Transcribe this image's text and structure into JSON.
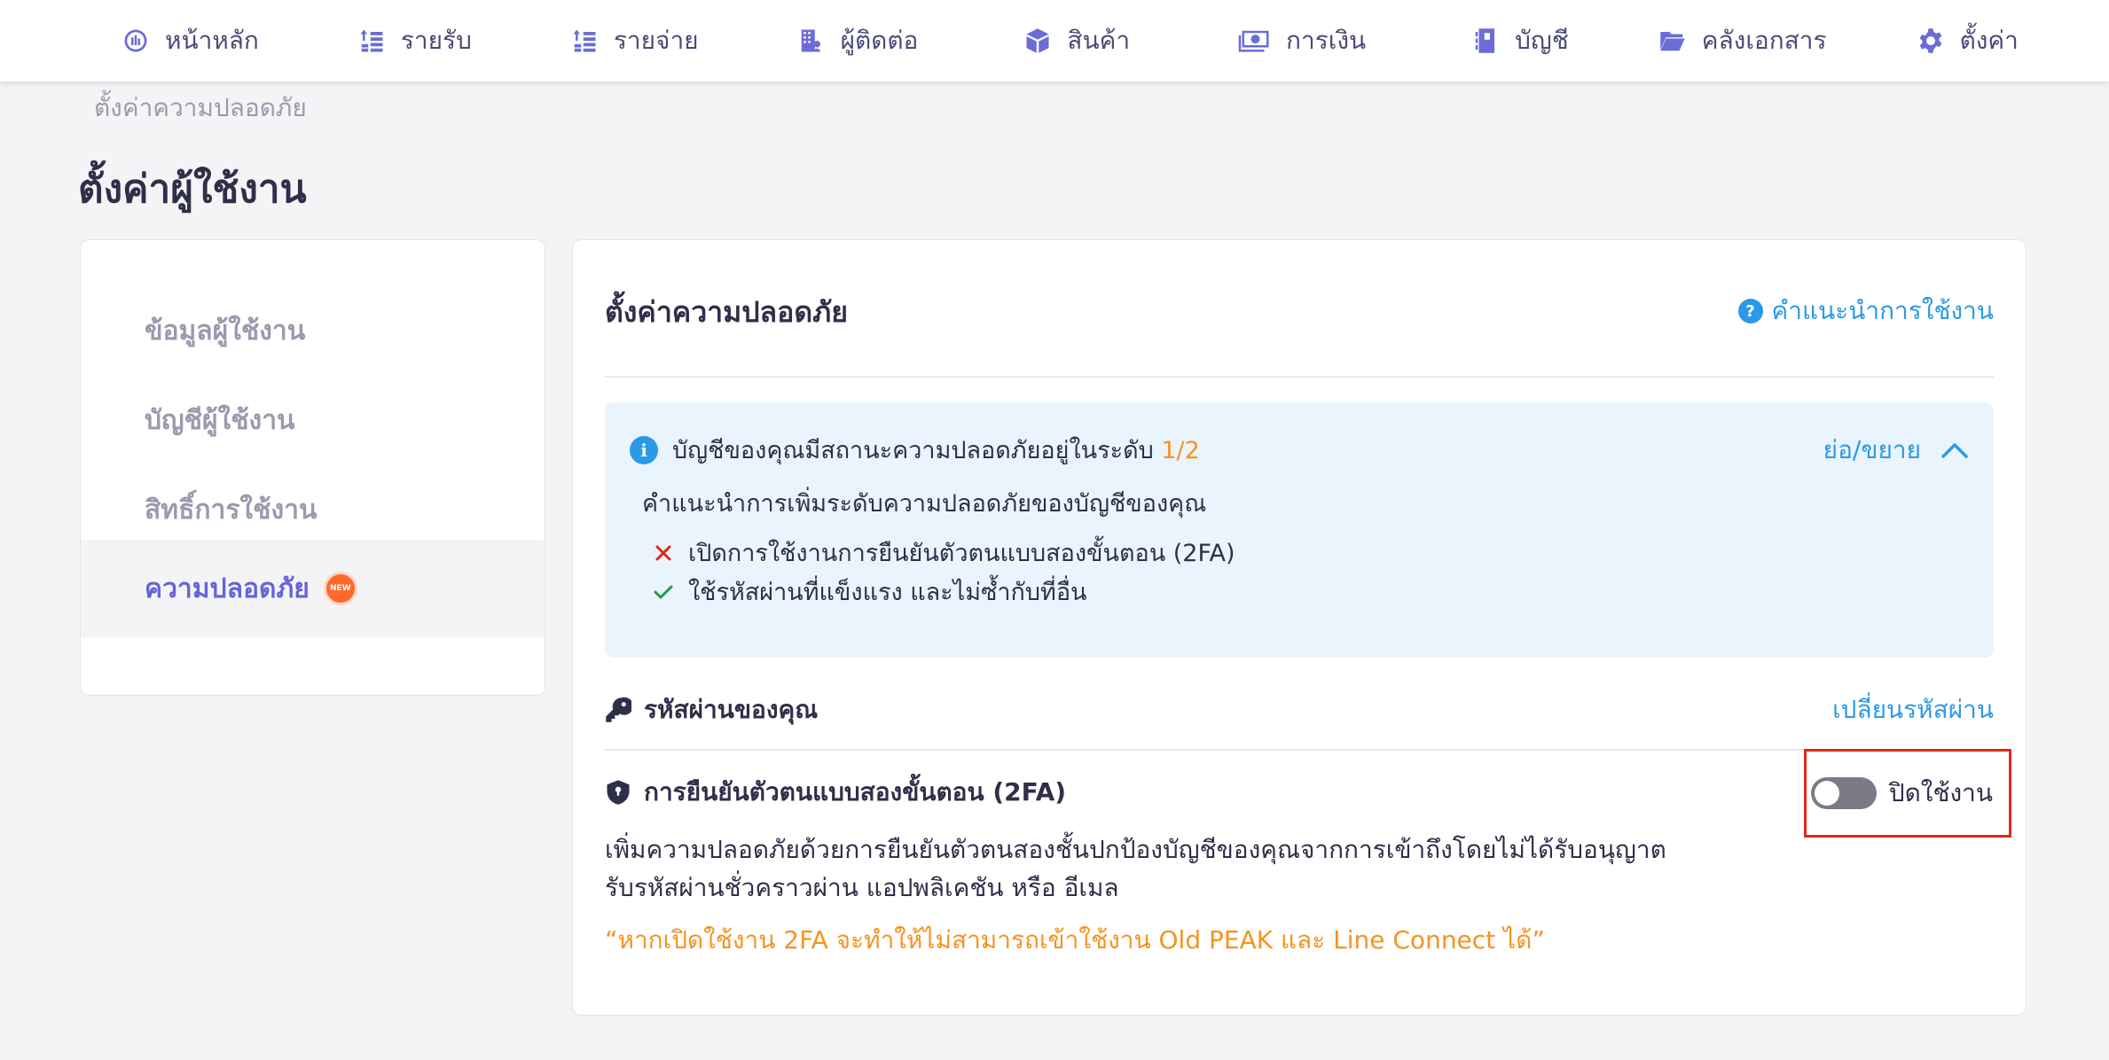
{
  "nav": {
    "items": [
      {
        "label": "หน้าหลัก",
        "icon": "dashboard-icon"
      },
      {
        "label": "รายรับ",
        "icon": "income-icon"
      },
      {
        "label": "รายจ่าย",
        "icon": "expense-icon"
      },
      {
        "label": "ผู้ติดต่อ",
        "icon": "contacts-icon"
      },
      {
        "label": "สินค้า",
        "icon": "product-box-icon"
      },
      {
        "label": "การเงิน",
        "icon": "money-icon"
      },
      {
        "label": "บัญชี",
        "icon": "ledger-icon"
      },
      {
        "label": "คลังเอกสาร",
        "icon": "folder-icon"
      },
      {
        "label": "ตั้งค่า",
        "icon": "gear-icon"
      }
    ]
  },
  "breadcrumb": "ตั้งค่าความปลอดภัย",
  "page_title": "ตั้งค่าผู้ใช้งาน",
  "sidebar": {
    "items": [
      {
        "label": "ข้อมูลผู้ใช้งาน"
      },
      {
        "label": "บัญชีผู้ใช้งาน"
      },
      {
        "label": "สิทธิ์การใช้งาน"
      },
      {
        "label": "ความปลอดภัย",
        "badge": "NEW"
      }
    ]
  },
  "card": {
    "title": "ตั้งค่าความปลอดภัย",
    "help_label": "คำแนะนำการใช้งาน",
    "help_icon": "?"
  },
  "info": {
    "status_prefix": "บัญชีของคุณมีสถานะความปลอดภัยอยู่ในระดับ",
    "level": "1/2",
    "collapse_label": "ย่อ/ขยาย",
    "advice_title": "คำแนะนำการเพิ่มระดับความปลอดภัยของบัญชีของคุณ",
    "advice": [
      {
        "text": "เปิดการใช้งานการยืนยันตัวตนแบบสองขั้นตอน (2FA)",
        "done": false
      },
      {
        "text": "ใช้รหัสผ่านที่แข็งแรง และไม่ซ้ำกับที่อื่น",
        "done": true
      }
    ]
  },
  "password": {
    "label": "รหัสผ่านของคุณ",
    "change_label": "เปลี่ยนรหัสผ่าน"
  },
  "tfa": {
    "label": "การยืนยันตัวตนแบบสองขั้นตอน (2FA)",
    "enabled": false,
    "toggle_label": "ปิดใช้งาน",
    "desc_line1": "เพิ่มความปลอดภัยด้วยการยืนยันตัวตนสองชั้นปกป้องบัญชีของคุณจากการเข้าถึงโดยไม่ได้รับอนุญาต",
    "desc_line2": "รับรหัสผ่านชั่วคราวผ่าน แอปพลิเคชัน หรือ อีเมล",
    "warning": "“หากเปิดใช้งาน 2FA จะทำให้ไม่สามารถเข้าใช้งาน Old PEAK และ Line Connect ได้”"
  },
  "colors": {
    "accent": "#6663d9",
    "link": "#2a9ae8",
    "warning": "#f7931e",
    "highlight_border": "#e0261a"
  }
}
